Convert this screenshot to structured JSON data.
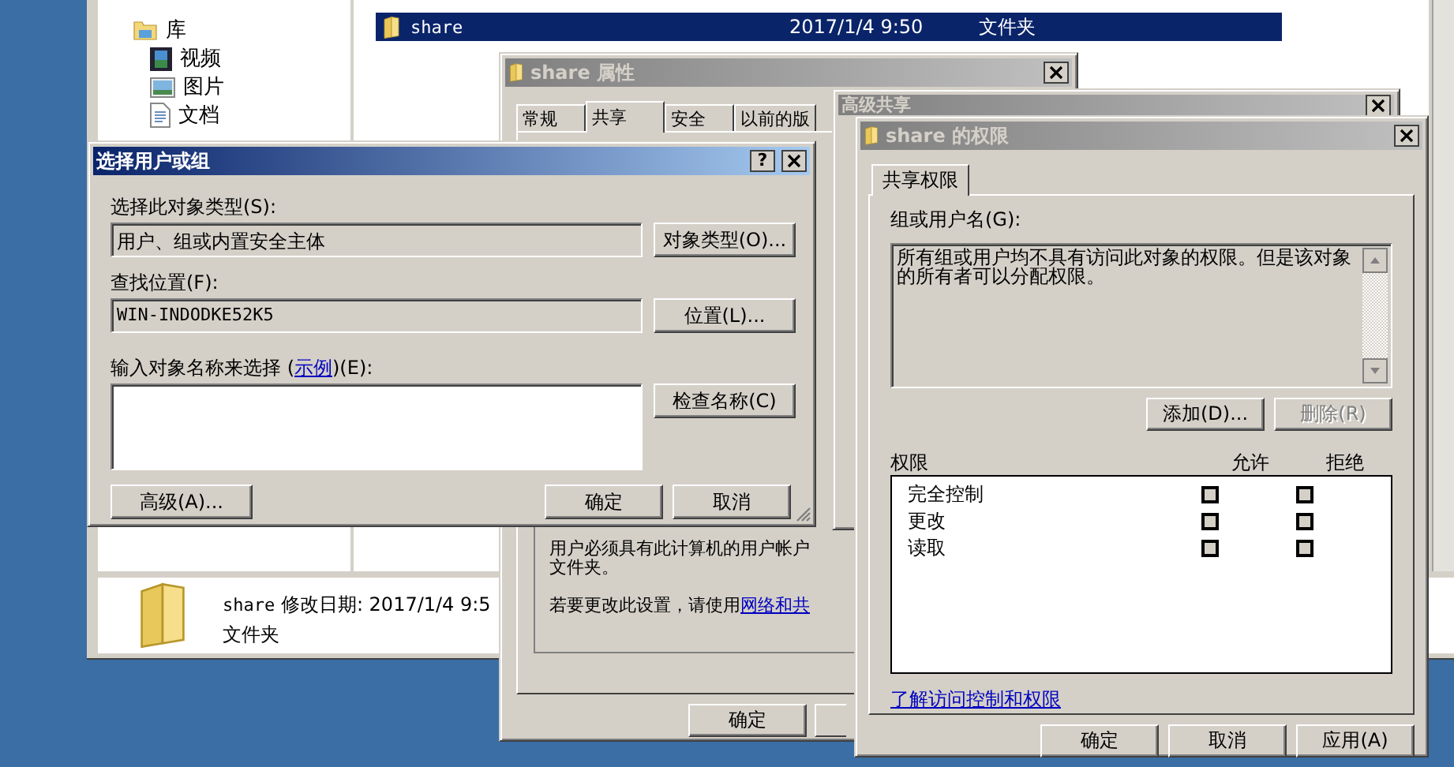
{
  "explorer": {
    "nav_items": [
      {
        "label": "库",
        "children": [
          {
            "label": "视频"
          },
          {
            "label": "图片"
          },
          {
            "label": "文档"
          }
        ]
      }
    ],
    "file_row": {
      "name": "share",
      "date": "2017/1/4 9:50",
      "type": "文件夹",
      "selected": true
    },
    "details": {
      "name": "share",
      "modified": "修改日期: 2017/1/4 9:5",
      "type": "文件夹"
    }
  },
  "properties_window": {
    "title": "share 属性",
    "tabs": [
      {
        "label": "常规",
        "selected": false
      },
      {
        "label": "共享",
        "selected": true
      },
      {
        "label": "安全",
        "selected": false
      },
      {
        "label": "以前的版",
        "selected": false
      }
    ],
    "note_lines": [
      "用户必须具有此计算机的用户帐户",
      "文件夹。"
    ],
    "change_text": "若要更改此设置，请使用",
    "change_link": "网络和共",
    "ok_button": "确定"
  },
  "advanced_sharing_window": {
    "title": "高级共享"
  },
  "select_dialog": {
    "title": "选择用户或组",
    "help_button": "?",
    "object_type_label": "选择此对象类型(S):",
    "object_type_value": "用户、组或内置安全主体",
    "object_type_button": "对象类型(O)...",
    "location_label": "查找位置(F):",
    "location_value": "WIN-INDODKE52K5",
    "location_button": "位置(L)...",
    "names_label": "输入对象名称来选择 (",
    "names_link": "示例",
    "names_label_end": ")(E):",
    "check_names_button": "检查名称(C)",
    "advanced_button": "高级(A)...",
    "ok_button": "确定",
    "cancel_button": "取消"
  },
  "permissions_window": {
    "title": "share 的权限",
    "tabs": [
      {
        "label": "共享权限",
        "selected": true
      }
    ],
    "group_label": "组或用户名(G):",
    "group_message": "所有组或用户均不具有访问此对象的权限。但是该对象的所有者可以分配权限。",
    "group_buttons": [
      {
        "label": "添加(D)...",
        "disabled": false
      },
      {
        "label": "删除(R)",
        "disabled": true
      }
    ],
    "permissions_header": "权限",
    "allow_header": "允许",
    "deny_header": "拒绝",
    "rows": [
      {
        "name": "完全控制",
        "allow": false,
        "deny": false
      },
      {
        "name": "更改",
        "allow": false,
        "deny": false
      },
      {
        "name": "读取",
        "allow": false,
        "deny": false
      }
    ],
    "help_link": "了解访问控制和权限",
    "buttons": [
      "确定",
      "取消",
      "应用(A)"
    ]
  }
}
